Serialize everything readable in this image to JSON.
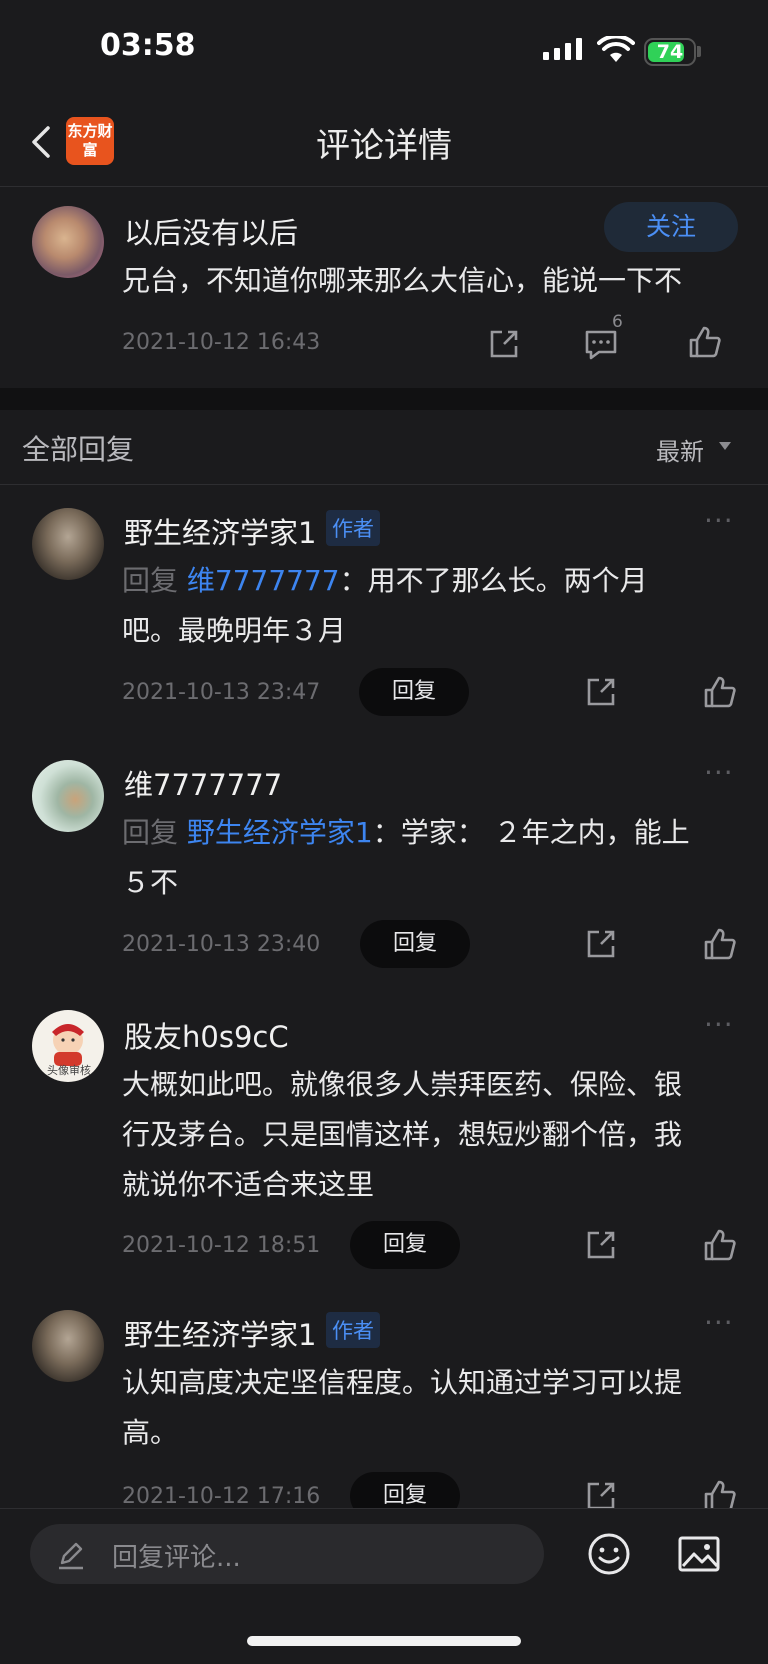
{
  "status": {
    "time": "03:58",
    "battery": "74"
  },
  "header": {
    "title": "评论详情",
    "logo_text": "东方财富"
  },
  "main_comment": {
    "username": "以后没有以后",
    "follow_label": "关注",
    "text": "兄台，不知道你哪来那么大信心，能说一下不",
    "timestamp": "2021-10-12 16:43",
    "reply_count": "6"
  },
  "replies_header": {
    "title": "全部回复",
    "sort": "最新"
  },
  "replies": [
    {
      "username": "野生经济学家1",
      "badge": "作者",
      "prefix": "回复",
      "target": "维7777777",
      "line1": "：用不了那么长。两个月",
      "line2": "吧。最晚明年３月",
      "timestamp": "2021-10-13 23:47",
      "reply_label": "回复"
    },
    {
      "username": "维7777777",
      "prefix": "回复",
      "target": "野生经济学家1",
      "line1": "：学家： ２年之内，能上",
      "line2": "５不",
      "timestamp": "2021-10-13 23:40",
      "reply_label": "回复"
    },
    {
      "username": "股友h0s9cC",
      "avatar_text": "头像审核",
      "line1": "大概如此吧。就像很多人崇拜医药、保险、银",
      "line2": "行及茅台。只是国情这样，想短炒翻个倍，我",
      "line3": "就说你不适合来这里",
      "timestamp": "2021-10-12 18:51",
      "reply_label": "回复"
    },
    {
      "username": "野生经济学家1",
      "badge": "作者",
      "line1": "认知高度决定坚信程度。认知通过学习可以提",
      "line2": "高。",
      "timestamp": "2021-10-12 17:16",
      "reply_label": "回复"
    }
  ],
  "bottom_bar": {
    "placeholder": "回复评论..."
  },
  "colors": {
    "accent": "#4b8ff5",
    "background": "#1b1b1d",
    "logo": "#e8541e"
  }
}
